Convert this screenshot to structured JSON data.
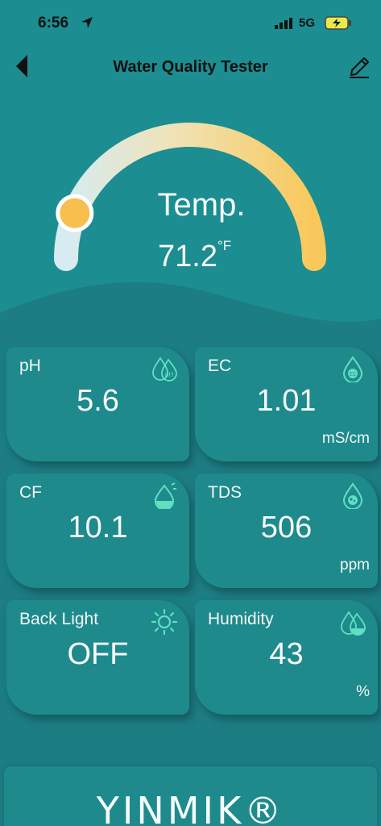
{
  "status_bar": {
    "time": "6:56",
    "network": "5G"
  },
  "header": {
    "title": "Water Quality Tester"
  },
  "gauge": {
    "label": "Temp.",
    "value": "71.2",
    "unit": "°F",
    "level_fraction": 0.12,
    "colors": {
      "start": "#d6ecf2",
      "end": "#f9c85a",
      "knob": "#f6bf4e"
    }
  },
  "cards": [
    {
      "label": "pH",
      "value": "5.6",
      "unit": "",
      "icon": "ph-drops-icon"
    },
    {
      "label": "EC",
      "value": "1.01",
      "unit": "mS/cm",
      "icon": "ec-drop-icon"
    },
    {
      "label": "CF",
      "value": "10.1",
      "unit": "",
      "icon": "cf-drop-icon"
    },
    {
      "label": "TDS",
      "value": "506",
      "unit": "ppm",
      "icon": "tds-drop-icon"
    },
    {
      "label": "Back Light",
      "value": "OFF",
      "unit": "",
      "icon": "sun-icon"
    },
    {
      "label": "Humidity",
      "value": "43",
      "unit": "%",
      "icon": "humidity-drops-icon"
    }
  ],
  "footer": {
    "brand": "YINMIK®"
  },
  "colors": {
    "background": "#1c7d83",
    "card": "#1e8a8c",
    "icon_accent": "#5fe0c2"
  }
}
